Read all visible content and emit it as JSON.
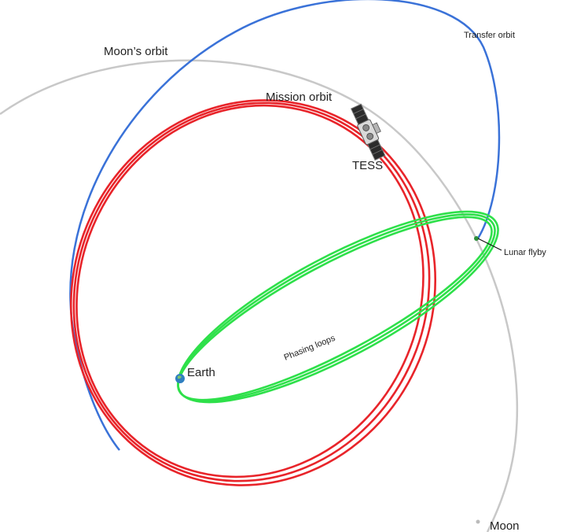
{
  "diagram": {
    "labels": {
      "moons_orbit": "Moon’s orbit",
      "transfer_orbit": "Transfer orbit",
      "mission_orbit": "Mission orbit",
      "tess": "TESS",
      "lunar_flyby": "Lunar flyby",
      "phasing_loops": "Phasing loops",
      "earth": "Earth",
      "moon": "Moon"
    },
    "colors": {
      "moon_orbit": "#c8c8c8",
      "transfer_orbit": "#3a72d8",
      "mission_orbit": "#e8242a",
      "phasing_loops": "#2ee04a",
      "earth": "#2f7fc0",
      "text": "#222222"
    }
  }
}
